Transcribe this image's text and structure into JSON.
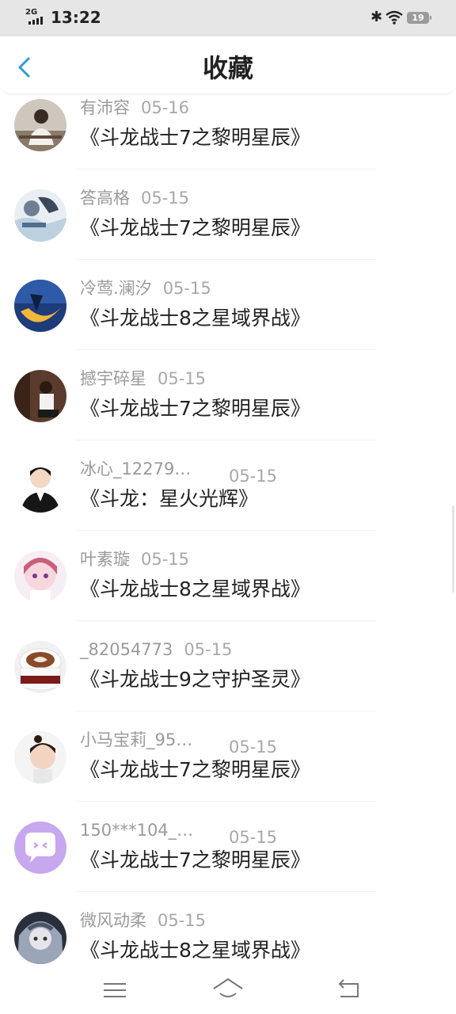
{
  "status_bar": {
    "network": "2G",
    "time": "13:22",
    "battery": "19"
  },
  "header": {
    "title": "收藏"
  },
  "favorites": [
    {
      "user": "有沛容",
      "date": "05-16",
      "work": "《斗龙战士7之黎明星辰》",
      "avatar": "person-sitting-photo"
    },
    {
      "user": "答高格",
      "date": "05-15",
      "work": "《斗龙战士7之黎明星辰》",
      "avatar": "anime-girl-photo"
    },
    {
      "user": "冷莺.澜汐",
      "date": "05-15",
      "work": "《斗龙战士8之星域界战》",
      "avatar": "moon-night-picture"
    },
    {
      "user": "撼宇碎星",
      "date": "05-15",
      "work": "《斗龙战士7之黎明星辰》",
      "avatar": "person-sitting-photo"
    },
    {
      "user": "冰心_12279…",
      "date": "05-15",
      "work": "《斗龙：星火光辉》",
      "avatar": "suited-person-photo"
    },
    {
      "user": "叶素璇",
      "date": "05-15",
      "work": "《斗龙战士8之星域界战》",
      "avatar": "anime-girl-picture"
    },
    {
      "user": "_82054773",
      "date": "05-15",
      "work": "《斗龙战士9之守护圣灵》",
      "avatar": "coffee-cup-picture"
    },
    {
      "user": "小马宝莉_95…",
      "date": "05-15",
      "work": "《斗龙战士7之黎明星辰》",
      "avatar": "child-photo"
    },
    {
      "user": "150***104_…",
      "date": "05-15",
      "work": "《斗龙战士7之黎明星辰》",
      "avatar": "default-chat-avatar"
    },
    {
      "user": "微风动柔",
      "date": "05-15",
      "work": "《斗龙战士8之星域界战》",
      "avatar": "dark-anime-picture"
    }
  ],
  "colors": {
    "accent": "#2f9bd6",
    "default_avatar": "#c7a8ef"
  }
}
